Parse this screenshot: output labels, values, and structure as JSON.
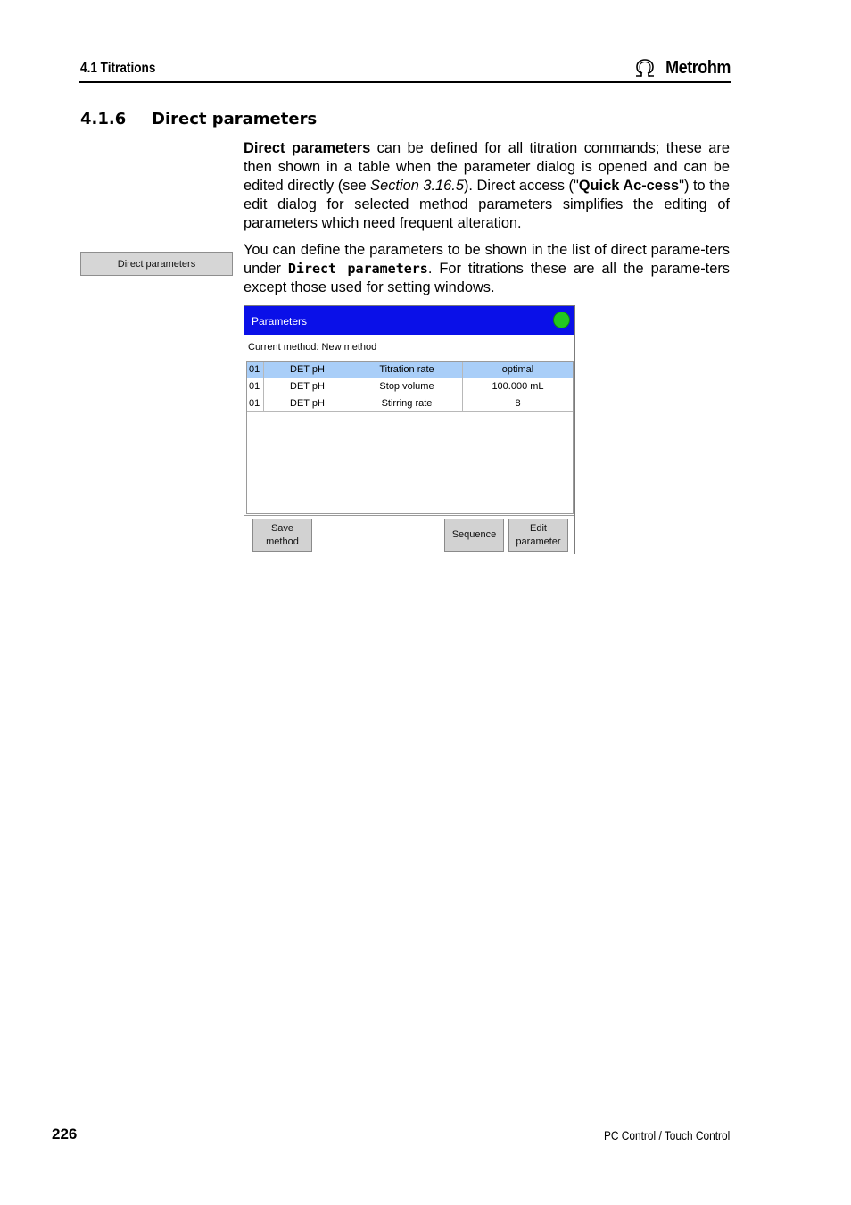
{
  "header": {
    "section": "4.1 Titrations",
    "brand": "Metrohm",
    "logo_icon": "metrohm-omega-logo-icon"
  },
  "section": {
    "number": "4.1.6",
    "title": "Direct parameters"
  },
  "para1": {
    "b1": "Direct parameters",
    "t1": " can be defined for all titration commands; these are then shown in a table when the parameter dialog is opened and can be edited directly (see ",
    "i1": "Section 3.16.5",
    "t2": "). Direct access (\"",
    "b2": "Quick Ac-cess",
    "t3": "\") to the edit dialog for selected method parameters simplifies the editing of parameters which need frequent alteration."
  },
  "para2": {
    "t1": "You can define the parameters to be shown in the list of direct parame-ters under ",
    "code": "Direct parameters",
    "t2": ". For titrations these are all the parame-ters except those used for setting windows."
  },
  "side_button": {
    "label": "Direct parameters"
  },
  "dialog": {
    "title": "Parameters",
    "status_color": "#22c81e",
    "current_method": "Current method: New method",
    "rows": [
      {
        "id": "01",
        "command": "DET pH",
        "parameter": "Titration rate",
        "value": "optimal",
        "selected": true
      },
      {
        "id": "01",
        "command": "DET pH",
        "parameter": "Stop volume",
        "value": "100.000 mL",
        "selected": false
      },
      {
        "id": "01",
        "command": "DET pH",
        "parameter": "Stirring rate",
        "value": "8",
        "selected": false
      }
    ],
    "buttons": {
      "save_line1": "Save",
      "save_line2": "method",
      "sequence": "Sequence",
      "edit_line1": "Edit",
      "edit_line2": "parameter"
    }
  },
  "footer": {
    "page_number": "226",
    "product": "PC Control / Touch Control"
  }
}
